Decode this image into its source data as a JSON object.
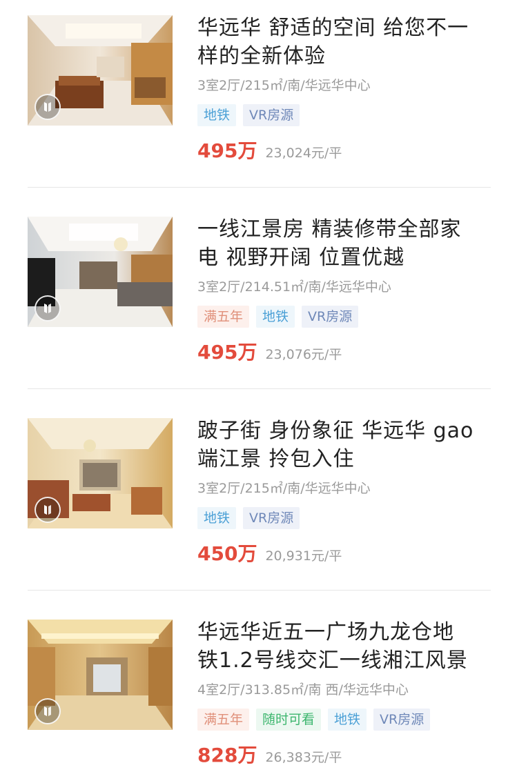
{
  "listings": [
    {
      "title_line1": "华远华  舒适的空间 给您不一",
      "title_line2": "样的全新体验",
      "meta": "3室2厅/215㎡/南/华远华中心",
      "tags": [
        {
          "label": "地铁",
          "kind": "subway"
        },
        {
          "label": "VR房源",
          "kind": "vr"
        }
      ],
      "price": "495万",
      "unit_price": "23,024元/平",
      "vr_icon": "vr-play-icon"
    },
    {
      "title_line1": "一线江景房 精装修带全部家",
      "title_line2": "电 视野开阔 位置优越",
      "meta": "3室2厅/214.51㎡/南/华远华中心",
      "tags": [
        {
          "label": "满五年",
          "kind": "five"
        },
        {
          "label": "地铁",
          "kind": "subway"
        },
        {
          "label": "VR房源",
          "kind": "vr"
        }
      ],
      "price": "495万",
      "unit_price": "23,076元/平",
      "vr_icon": "vr-play-icon"
    },
    {
      "title_line1": "跛子街 身份象征 华远华 gao",
      "title_line2": "端江景 拎包入住",
      "meta": "3室2厅/215㎡/南/华远华中心",
      "tags": [
        {
          "label": "地铁",
          "kind": "subway"
        },
        {
          "label": "VR房源",
          "kind": "vr"
        }
      ],
      "price": "450万",
      "unit_price": "20,931元/平",
      "vr_icon": "vr-play-icon"
    },
    {
      "title_line1": "华远华近五一广场九龙仓地",
      "title_line2": "铁1.2号线交汇一线湘江风景",
      "meta": "4室2厅/313.85㎡/南 西/华远华中心",
      "tags": [
        {
          "label": "满五年",
          "kind": "five"
        },
        {
          "label": "随时可看",
          "kind": "anytime"
        },
        {
          "label": "地铁",
          "kind": "subway"
        },
        {
          "label": "VR房源",
          "kind": "vr"
        }
      ],
      "price": "828万",
      "unit_price": "26,383元/平",
      "vr_icon": "vr-play-icon"
    }
  ],
  "colors": {
    "price": "#e34b3c",
    "title": "#222222",
    "meta": "#9a9a9a"
  }
}
